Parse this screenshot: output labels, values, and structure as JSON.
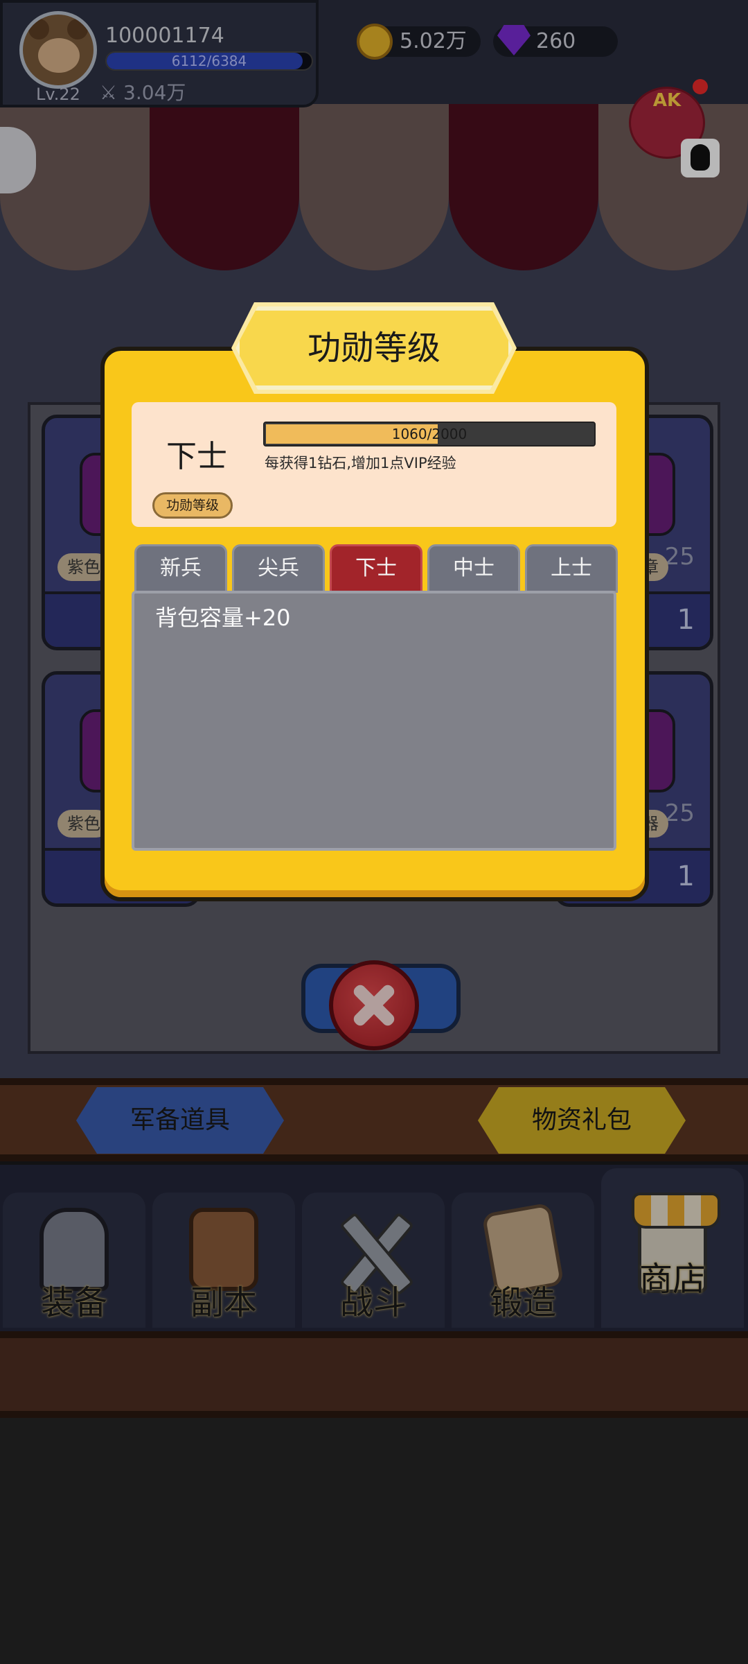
{
  "header": {
    "user_id": "100001174",
    "exp_text": "6112/6384",
    "exp_ratio": 0.957,
    "level": "Lv.22",
    "power": "3.04万",
    "coins": "5.02万",
    "gems": "260"
  },
  "event_badge": {
    "label": "AK"
  },
  "shop": {
    "card_labels": [
      "紫色",
      "甲徽章",
      "紫色",
      "器武器"
    ],
    "card_counts": [
      "25",
      "25"
    ],
    "card_prices": [
      "1",
      "1"
    ]
  },
  "modal": {
    "title": "功勋等级",
    "rank": "下士",
    "progress_text": "1060/2000",
    "progress_ratio": 0.53,
    "hint": "每获得1钻石,增加1点VIP经验",
    "merit_button": "功勋等级",
    "tabs": [
      "新兵",
      "尖兵",
      "下士",
      "中士",
      "上士"
    ],
    "active_tab": 2,
    "benefits": [
      "背包容量+20"
    ]
  },
  "shop_tabs": {
    "left": "军备道具",
    "right": "物资礼包"
  },
  "nav": {
    "items": [
      "装备",
      "副本",
      "战斗",
      "锻造",
      "商店"
    ],
    "active": 4
  },
  "colors": {
    "modal_bg": "#f9c71a",
    "active_tab": "#a2242a",
    "progress_fill": "#f0bb5a"
  }
}
